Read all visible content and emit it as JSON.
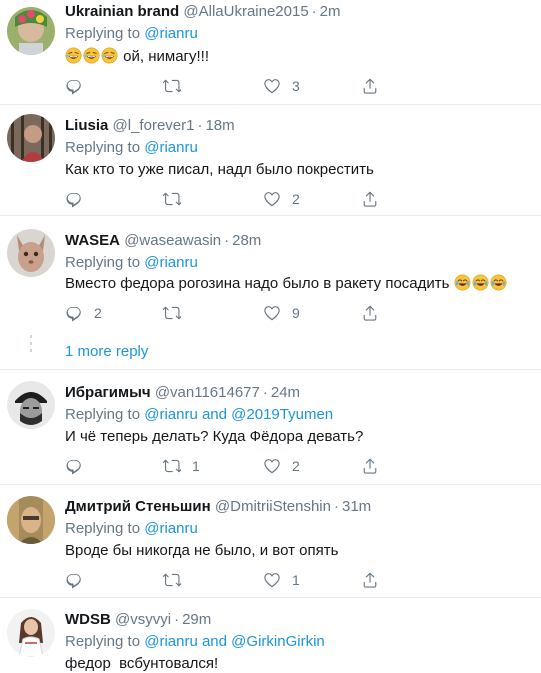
{
  "tweets": [
    {
      "name": "Ukrainian brand",
      "handle": "@AllaUkraine2015",
      "time": "2m",
      "replying_prefix": "Replying to",
      "replying_to": [
        "@rianru"
      ],
      "text": "ой, нимагу!!!",
      "emoji": [
        "rofl-emoji",
        "rofl-emoji",
        "rofl-emoji"
      ],
      "counts": {
        "reply": "",
        "retweet": "",
        "like": "3"
      }
    },
    {
      "name": "Liusia",
      "handle": "@l_forever1",
      "time": "18m",
      "replying_prefix": "Replying to",
      "replying_to": [
        "@rianru"
      ],
      "text": "Как кто то уже писал, надл было покрестить",
      "counts": {
        "reply": "",
        "retweet": "",
        "like": "2"
      }
    },
    {
      "name": "WASEA",
      "handle": "@waseawasin",
      "time": "28m",
      "replying_prefix": "Replying to",
      "replying_to": [
        "@rianru"
      ],
      "text": "Вместо федора рогозина надо было в ракету посадить",
      "emoji": [
        "joy-emoji",
        "joy-emoji",
        "joy-emoji"
      ],
      "counts": {
        "reply": "2",
        "retweet": "",
        "like": "9"
      }
    },
    {
      "name": "Ибрагимыч",
      "handle": "@van11614677",
      "time": "24m",
      "replying_prefix": "Replying to",
      "replying_to": [
        "@rianru",
        "@2019Tyumen"
      ],
      "replying_joiner": "and",
      "text": "И чё теперь делать? Куда Фёдора девать?",
      "counts": {
        "reply": "",
        "retweet": "1",
        "like": "2"
      }
    },
    {
      "name": "Дмитрий Стеньшин",
      "handle": "@DmitriiStenshin",
      "time": "31m",
      "replying_prefix": "Replying to",
      "replying_to": [
        "@rianru"
      ],
      "text": "Вроде бы никогда не было, и вот опять",
      "counts": {
        "reply": "",
        "retweet": "",
        "like": "1"
      }
    },
    {
      "name": "WDSB",
      "handle": "@vsyvyi",
      "time": "29m",
      "replying_prefix": "Replying to",
      "replying_to": [
        "@rianru",
        "@GirkinGirkin"
      ],
      "replying_joiner": "and",
      "text": "федор  всбунтовался!"
    }
  ],
  "more_reply_label": "1 more reply",
  "separator": "·",
  "colors": {
    "link": "#1b95e0",
    "muted": "#657786",
    "border": "#e6ecf0"
  }
}
